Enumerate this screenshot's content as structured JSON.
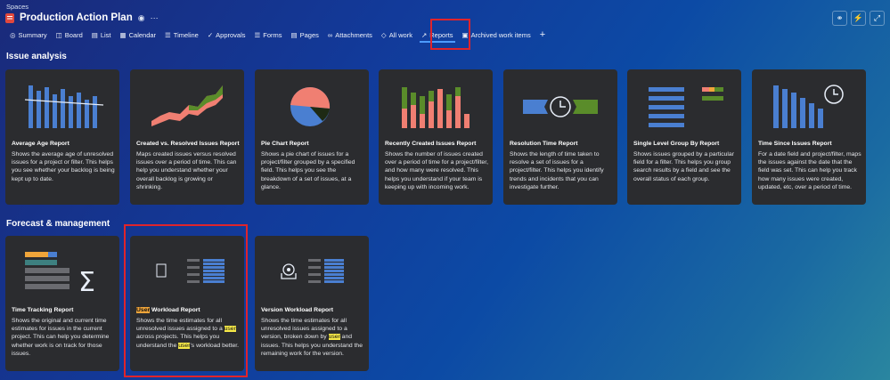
{
  "breadcrumb": "Spaces",
  "project": {
    "title": "Production Action Plan"
  },
  "tabs": [
    {
      "label": "Summary",
      "icon": "globe-icon"
    },
    {
      "label": "Board",
      "icon": "board-icon"
    },
    {
      "label": "List",
      "icon": "list-icon"
    },
    {
      "label": "Calendar",
      "icon": "calendar-icon"
    },
    {
      "label": "Timeline",
      "icon": "timeline-icon"
    },
    {
      "label": "Approvals",
      "icon": "approvals-icon"
    },
    {
      "label": "Forms",
      "icon": "forms-icon"
    },
    {
      "label": "Pages",
      "icon": "pages-icon"
    },
    {
      "label": "Attachments",
      "icon": "attachment-icon"
    },
    {
      "label": "All work",
      "icon": "all-work-icon"
    },
    {
      "label": "Reports",
      "icon": "reports-icon",
      "active": true
    },
    {
      "label": "Archived work items",
      "icon": "archive-icon"
    }
  ],
  "sections": {
    "issue_analysis": "Issue analysis",
    "forecast": "Forecast & management"
  },
  "issue_cards": [
    {
      "title": "Average Age Report",
      "desc": "Shows the average age of unresolved issues for a project or filter. This helps you see whether your backlog is being kept up to date."
    },
    {
      "title": "Created vs. Resolved Issues Report",
      "desc": "Maps created issues versus resolved issues over a period of time. This can help you understand whether your overall backlog is growing or shrinking."
    },
    {
      "title": "Pie Chart Report",
      "desc": "Shows a pie chart of issues for a project/filter grouped by a specified field. This helps you see the breakdown of a set of issues, at a glance."
    },
    {
      "title": "Recently Created Issues Report",
      "desc": "Shows the number of issues created over a period of time for a project/filter, and how many were resolved. This helps you understand if your team is keeping up with incoming work."
    },
    {
      "title": "Resolution Time Report",
      "desc": "Shows the length of time taken to resolve a set of issues for a project/filter. This helps you identify trends and incidents that you can investigate further."
    },
    {
      "title": "Single Level Group By Report",
      "desc": "Shows issues grouped by a particular field for a filter. This helps you group search results by a field and see the overall status of each group."
    },
    {
      "title": "Time Since Issues Report",
      "desc": "For a date field and project/filter, maps the issues against the date that the field was set. This can help you track how many issues were created, updated, etc, over a period of time."
    }
  ],
  "forecast_cards": {
    "time_tracking": {
      "title": "Time Tracking Report",
      "desc": "Shows the original and current time estimates for issues in the current project. This can help you determine whether work is on track for those issues."
    },
    "user_workload": {
      "title_hl": "User",
      "title_rest": " Workload Report",
      "d1": "Shows the time estimates for all unresolved issues assigned to a ",
      "hl1": "user",
      "d2": " across projects. This helps you understand the ",
      "hl2": "user",
      "d3": "'s workload better."
    },
    "version_workload": {
      "title": "Version Workload Report",
      "d1": "Shows the time estimates for all unresolved issues assigned to a version, broken down by ",
      "hl1": "user",
      "d2": " and issues. This helps you understand the remaining work for the version."
    }
  },
  "colors": {
    "accent": "#4d9bff",
    "highlight_box": "#e0242b",
    "card_bg": "#2b2c2f"
  }
}
